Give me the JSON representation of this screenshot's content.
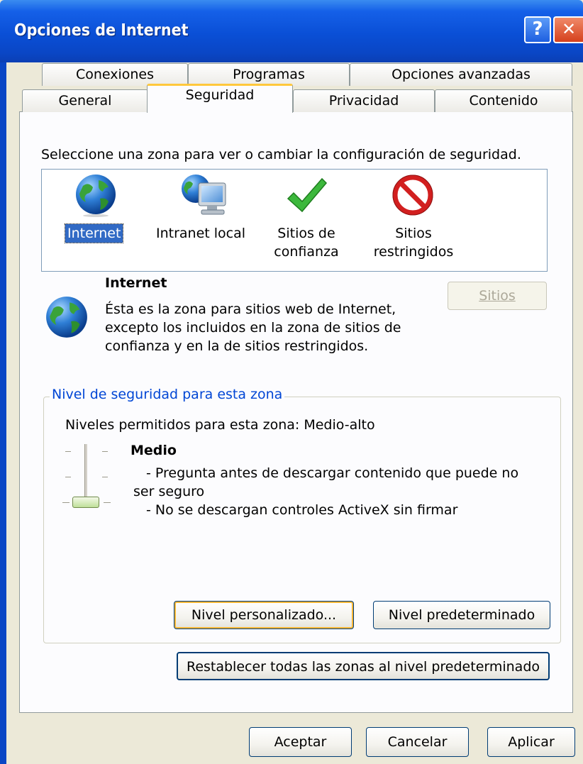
{
  "window": {
    "title": "Opciones de Internet",
    "help_glyph": "?",
    "close_glyph": "✕"
  },
  "tabs_row1": [
    {
      "label": "Conexiones"
    },
    {
      "label": "Programas"
    },
    {
      "label": "Opciones avanzadas"
    }
  ],
  "tabs_row2": [
    {
      "label": "General"
    },
    {
      "label": "Seguridad",
      "active": true
    },
    {
      "label": "Privacidad"
    },
    {
      "label": "Contenido"
    }
  ],
  "security": {
    "instruction": "Seleccione una zona para ver o cambiar la configuración de seguridad.",
    "zones": [
      {
        "label": "Internet",
        "icon": "globe-icon",
        "selected": true
      },
      {
        "label": "Intranet local",
        "icon": "intranet-icon"
      },
      {
        "label_line1": "Sitios de",
        "label_line2": "confianza",
        "icon": "checkmark-icon"
      },
      {
        "label_line1": "Sitios",
        "label_line2": "restringidos",
        "icon": "prohibited-icon"
      }
    ],
    "selected_zone": {
      "title": "Internet",
      "desc_line1": "Ésta es la zona para sitios web de Internet,",
      "desc_line2": "excepto los incluidos en la zona de sitios de",
      "desc_line3": "confianza y en la de sitios restringidos.",
      "sites_button": "Sitios"
    },
    "level_group": {
      "label": "Nivel de seguridad para esta zona",
      "allowed": "Niveles permitidos para esta zona: Medio-alto",
      "level_name": "Medio",
      "bullet1_line1": "- Pregunta antes de descargar contenido que puede no",
      "bullet1_line2": "ser seguro",
      "bullet2": "- No se descargan controles ActiveX sin firmar",
      "custom_button": "Nivel personalizado...",
      "default_button": "Nivel predeterminado"
    },
    "reset_button": "Restablecer todas las zonas al nivel predeterminado"
  },
  "footer": {
    "ok": "Aceptar",
    "cancel": "Cancelar",
    "apply": "Aplicar"
  },
  "colors": {
    "titlebar": "#0a46c5",
    "dialog_bg": "#ece9d8",
    "active_tab_accent": "#ffc83c",
    "group_label": "#0046d5"
  }
}
